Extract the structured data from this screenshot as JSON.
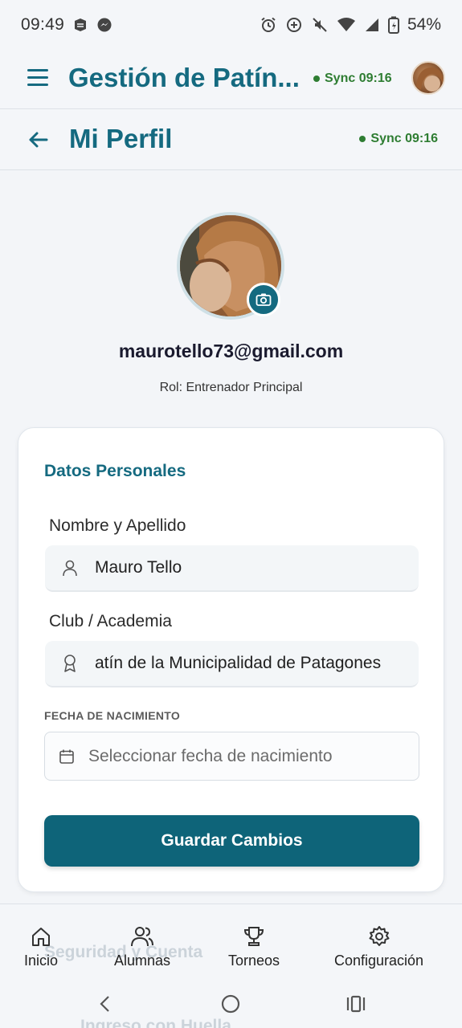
{
  "status_bar": {
    "time": "09:49",
    "battery": "54%"
  },
  "app_bar": {
    "title": "Gestión de Patín...",
    "sync_text": "Sync 09:16"
  },
  "subheader": {
    "title": "Mi Perfil",
    "sync_text": "Sync 09:16"
  },
  "profile": {
    "email": "maurotello73@gmail.com",
    "role": "Rol: Entrenador Principal"
  },
  "personal_data": {
    "section_title": "Datos Personales",
    "name_label": "Nombre y Apellido",
    "name_value": "Mauro Tello",
    "club_label": "Club / Academia",
    "club_value": "atín de la Municipalidad de Patagones",
    "birthdate_label": "FECHA DE NACIMIENTO",
    "birthdate_placeholder": "Seleccionar fecha de nacimiento",
    "save_label": "Guardar Cambios"
  },
  "peek": {
    "security_title": "Seguridad y Cuenta",
    "fingerprint": "Ingreso con Huella"
  },
  "bottom_nav": {
    "items": [
      {
        "label": "Inicio",
        "icon": "home-icon"
      },
      {
        "label": "Alumnas",
        "icon": "users-icon"
      },
      {
        "label": "Torneos",
        "icon": "trophy-icon"
      },
      {
        "label": "Configuración",
        "icon": "gear-icon"
      }
    ]
  },
  "colors": {
    "primary": "#156a80",
    "sync_green": "#2e7d32",
    "button": "#0e6479"
  }
}
